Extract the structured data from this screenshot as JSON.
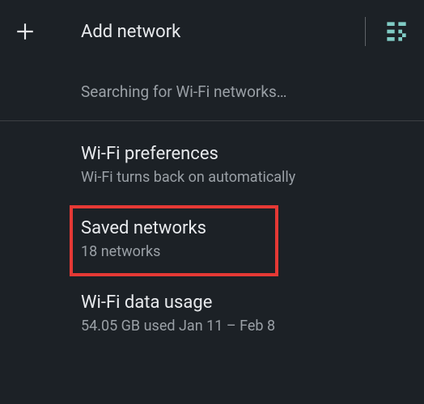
{
  "header": {
    "add_network_label": "Add network"
  },
  "status": {
    "searching_text": "Searching for Wi-Fi networks…"
  },
  "items": [
    {
      "title": "Wi-Fi preferences",
      "subtitle": "Wi-Fi turns back on automatically"
    },
    {
      "title": "Saved networks",
      "subtitle": "18 networks"
    },
    {
      "title": "Wi-Fi data usage",
      "subtitle": "54.05 GB used Jan 11 – Feb 8"
    }
  ]
}
